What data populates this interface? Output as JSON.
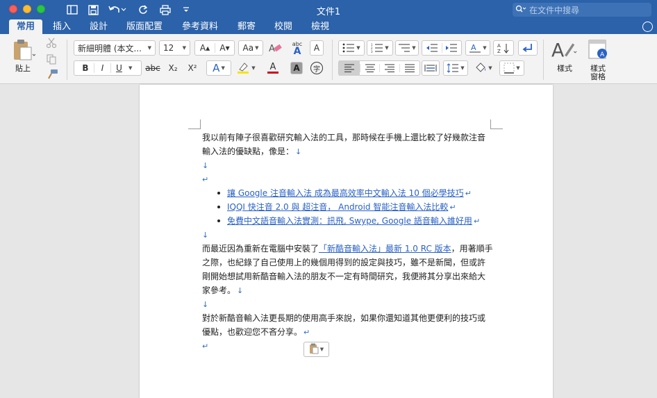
{
  "window": {
    "title": "文件1",
    "search_placeholder": "在文件中搜尋"
  },
  "tabs": [
    "常用",
    "插入",
    "設計",
    "版面配置",
    "參考資料",
    "郵寄",
    "校閱",
    "檢視"
  ],
  "ribbon": {
    "paste_label": "貼上",
    "font_name": "新細明體 (本文...",
    "font_size": "12",
    "styles_label": "樣式",
    "styles_pane_label_1": "樣式",
    "styles_pane_label_2": "窗格",
    "bold": "B",
    "italic": "I",
    "underline": "U",
    "strike": "abc",
    "abc": "abc",
    "sub": "X₂",
    "sup": "X²",
    "grow": "A▴",
    "shrink": "A▾",
    "change_case": "Aa",
    "text_effects": "A",
    "font_color": "A",
    "char_shading": "A",
    "enclose_char": "字",
    "phonetic_a": "A",
    "char_border": "A"
  },
  "document": {
    "para1": [
      "我以前有陣子很喜歡研究輸入法的工具，那時候在手機上還比較了好幾款注音",
      "輸入法的優缺點，像是："
    ],
    "list_items": [
      "讓 Google 注音輸入法 成為最高效率中文輸入法 10 個必學技巧",
      "IQQI 快注音 2.0 與 超注音， Android 智能注音輸入法比較",
      "免費中文語音輸入法實測：訊飛, Swype, Google 語音輸入誰好用"
    ],
    "para2_before_link": "而最近因為重新在電腦中安裝了",
    "para2_link": "「新酷音輸入法」最新 1.0 RC 版本",
    "para2_after_link": "，用著順手",
    "para2_lines": [
      "之際，也紀錄了自己使用上的幾個用得到的設定與技巧，雖不是新聞，但或許",
      "剛開始想試用新酷音輸入法的朋友不一定有時間研究，我便將其分享出來給大",
      "家參考。"
    ],
    "para3": [
      "對於新酷音輸入法更長期的使用高手來說，如果你還知道其他更便利的技巧或",
      "優點，也歡迎您不吝分享。"
    ],
    "line_break_mark": "↓",
    "para_mark": "↵"
  }
}
